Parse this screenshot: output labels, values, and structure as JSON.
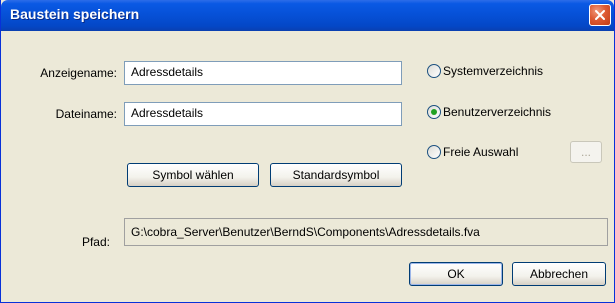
{
  "dialog": {
    "title": "Baustein speichern"
  },
  "fields": {
    "display_name": {
      "label": "Anzeigename:",
      "value": "Adressdetails"
    },
    "file_name": {
      "label": "Dateiname:",
      "value": "Adressdetails"
    },
    "path": {
      "label": "Pfad:",
      "value": "G:\\cobra_Server\\Benutzer\\BerndS\\Components\\Adressdetails.fva"
    }
  },
  "location": {
    "options": [
      {
        "label": "Systemverzeichnis",
        "selected": false
      },
      {
        "label": "Benutzerverzeichnis",
        "selected": true
      },
      {
        "label": "Freie Auswahl",
        "selected": false
      }
    ],
    "browse_label": "..."
  },
  "buttons": {
    "choose_symbol": "Symbol wählen",
    "default_symbol": "Standardsymbol",
    "ok": "OK",
    "cancel": "Abbrechen"
  },
  "colors": {
    "titlebar": "#0650d6",
    "dialog_bg": "#ece9d8",
    "radio_dot": "#21a121",
    "close_button": "#dd5a33"
  }
}
